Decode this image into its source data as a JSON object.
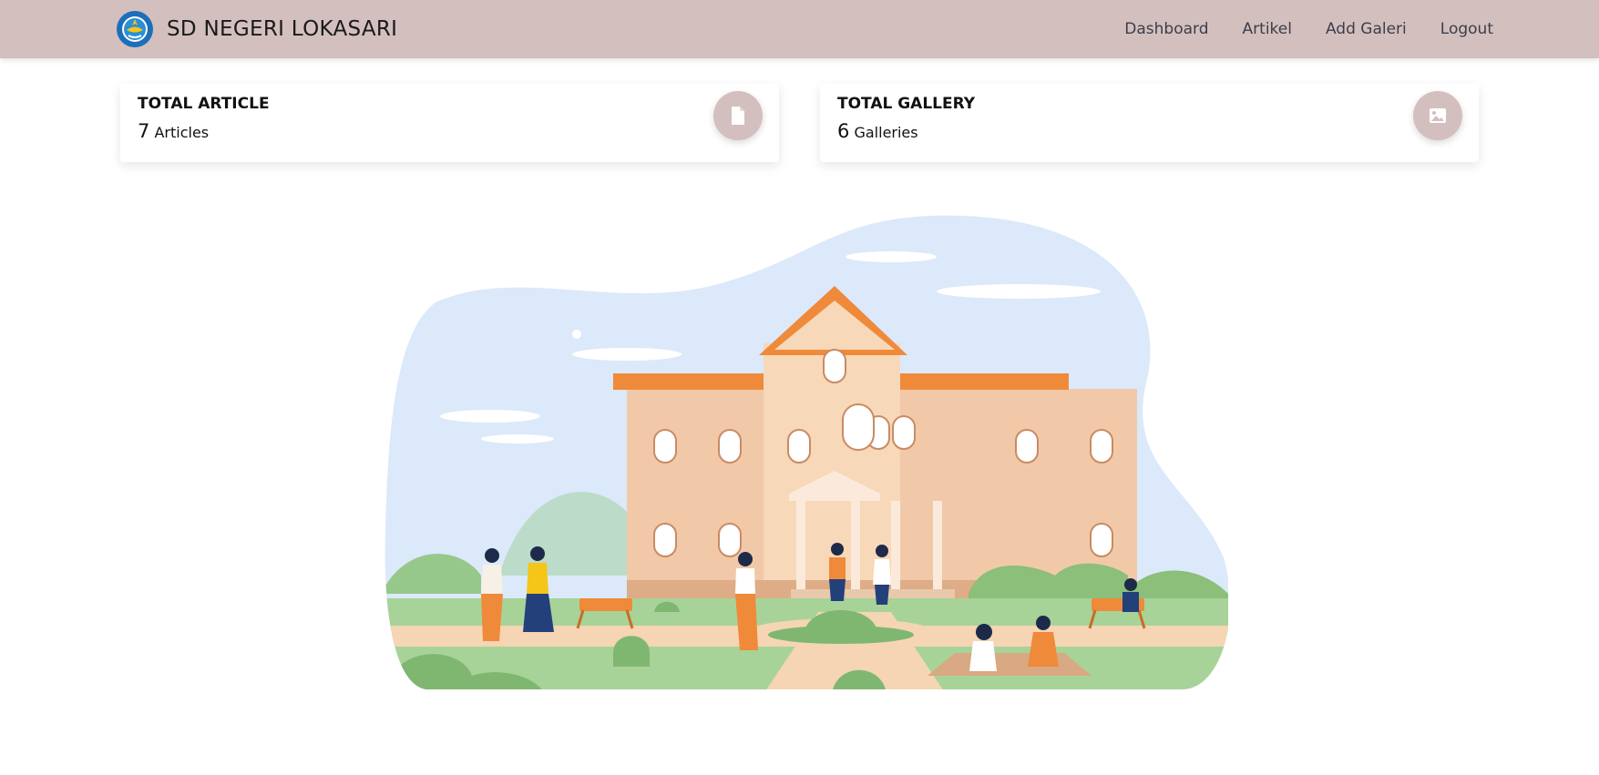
{
  "brand": {
    "title": "SD NEGERI LOKASARI"
  },
  "nav": {
    "items": [
      "Dashboard",
      "Artikel",
      "Add Galeri",
      "Logout"
    ]
  },
  "cards": [
    {
      "title": "TOTAL ARTICLE",
      "count": "7",
      "unit": "Articles",
      "icon": "file-icon"
    },
    {
      "title": "TOTAL GALLERY",
      "count": "6",
      "unit": "Galleries",
      "icon": "image-icon"
    }
  ],
  "colors": {
    "navbar": "#d4bfbf",
    "accent": "#ef8a3a",
    "sky": "#dbe9fb",
    "building": "#f2c9a8",
    "grass": "#a8d398"
  }
}
